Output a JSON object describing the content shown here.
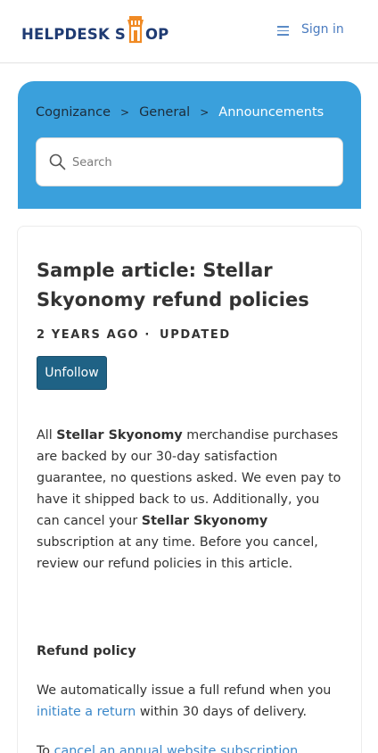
{
  "header": {
    "logo_left": "HELPDESK S",
    "logo_right": "OP",
    "menu_icon": "hamburger-menu-icon",
    "signin_label": "Sign in"
  },
  "breadcrumb": {
    "items": [
      "Cognizance",
      "General",
      "Announcements"
    ],
    "separator": ">"
  },
  "search": {
    "placeholder": "Search",
    "icon": "search-icon"
  },
  "article": {
    "title": "Sample article: Stellar Skyonomy refund policies",
    "meta_age": "2 YEARS AGO",
    "meta_dot": "·",
    "meta_updated": "UPDATED",
    "unfollow_label": "Unfollow",
    "p1_a": "All ",
    "p1_b": "Stellar Skyonomy",
    "p1_c": " merchandise purchases are backed by our 30-day satisfaction guarantee, no questions asked. We even pay to have it shipped back to us. Additionally, you can cancel your ",
    "p1_d": "Stellar Skyonomy",
    "p1_e": " subscription at any time. Before you cancel, review our refund policies in this article.",
    "h_refund": "Refund policy",
    "p2_a": "We automatically issue a full refund when you ",
    "p2_link": "initiate a return",
    "p2_b": " within 30 days of delivery.",
    "p3_a": "To ",
    "p3_link": "cancel an annual website subscription"
  },
  "colors": {
    "hero": "#3aa0dc",
    "brand_navy": "#1f3b73",
    "brand_orange": "#f08a24",
    "button": "#1f6285",
    "link": "#3a87c9"
  }
}
